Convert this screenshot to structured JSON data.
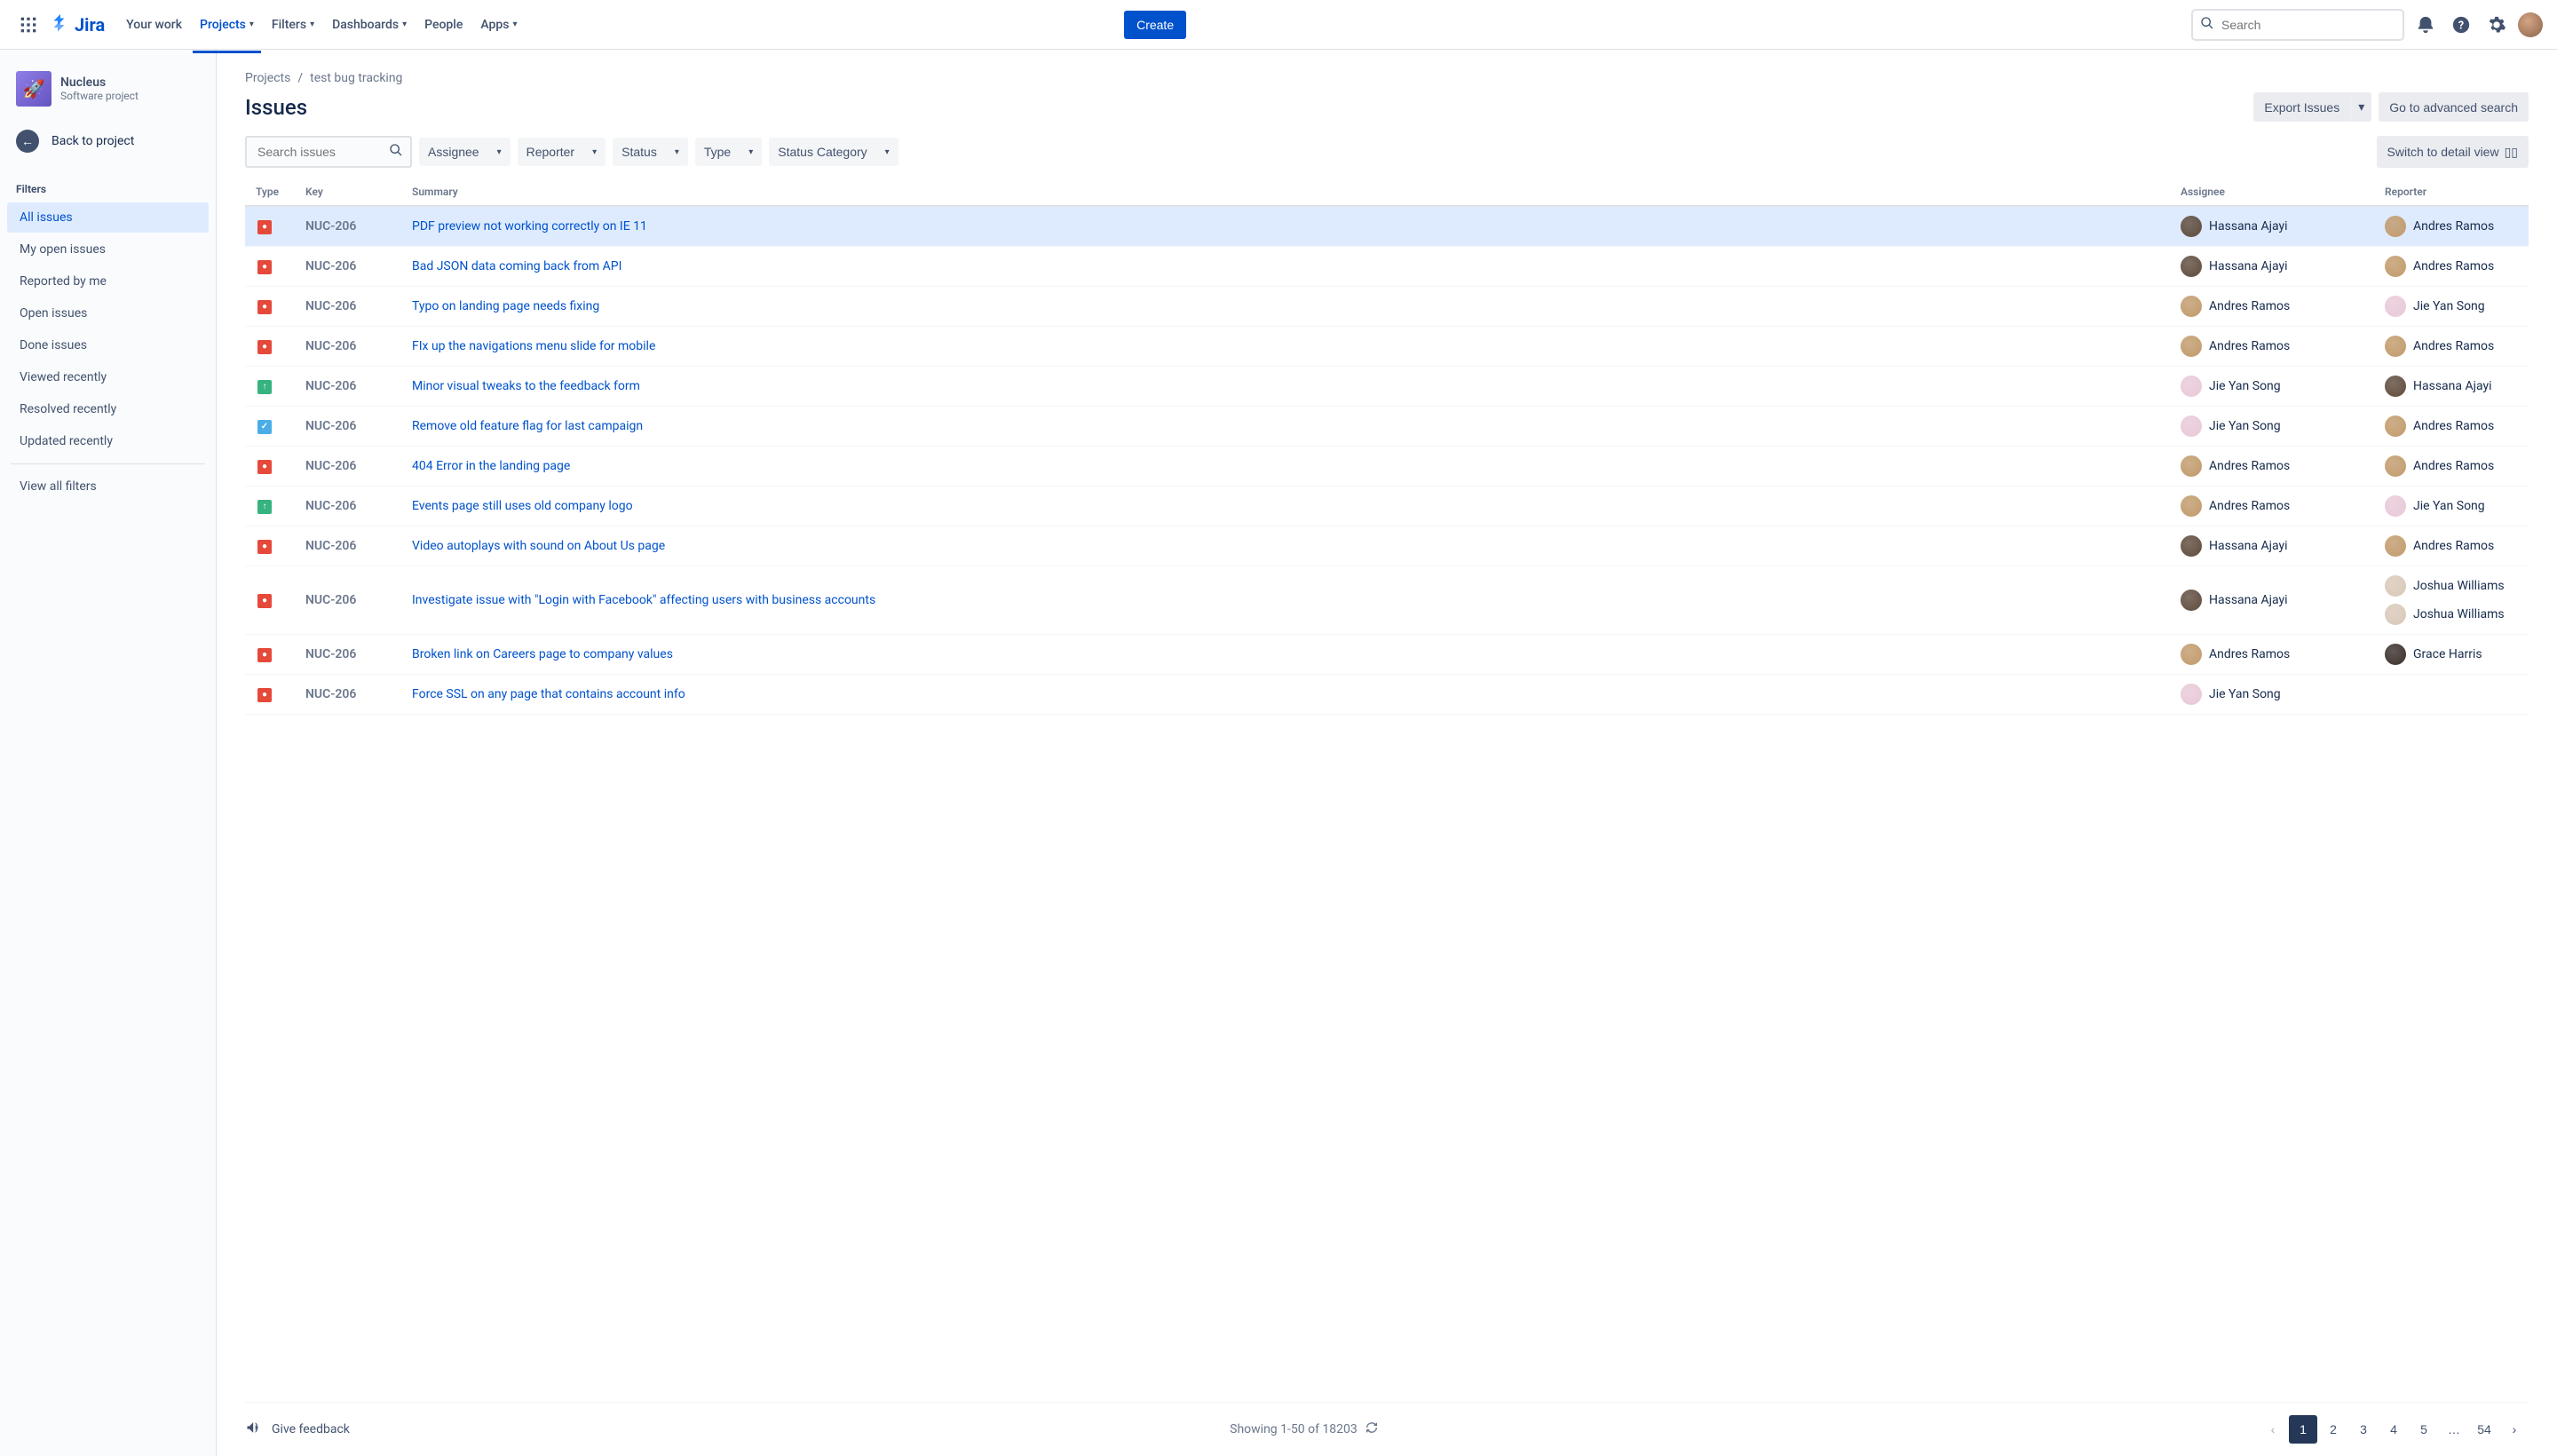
{
  "topnav": {
    "logo_text": "Jira",
    "items": [
      {
        "label": "Your work",
        "has_chevron": false,
        "active": false
      },
      {
        "label": "Projects",
        "has_chevron": true,
        "active": true
      },
      {
        "label": "Filters",
        "has_chevron": true,
        "active": false
      },
      {
        "label": "Dashboards",
        "has_chevron": true,
        "active": false
      },
      {
        "label": "People",
        "has_chevron": false,
        "active": false
      },
      {
        "label": "Apps",
        "has_chevron": true,
        "active": false
      }
    ],
    "create_label": "Create",
    "search_placeholder": "Search"
  },
  "sidebar": {
    "project_name": "Nucleus",
    "project_type": "Software project",
    "back_label": "Back to project",
    "filters_heading": "Filters",
    "filters": [
      {
        "label": "All issues",
        "active": true
      },
      {
        "label": "My open issues",
        "active": false
      },
      {
        "label": "Reported by me",
        "active": false
      },
      {
        "label": "Open issues",
        "active": false
      },
      {
        "label": "Done issues",
        "active": false
      },
      {
        "label": "Viewed recently",
        "active": false
      },
      {
        "label": "Resolved recently",
        "active": false
      },
      {
        "label": "Updated recently",
        "active": false
      }
    ],
    "view_all_label": "View all filters"
  },
  "breadcrumb": {
    "root": "Projects",
    "current": "test bug tracking"
  },
  "page_title": "Issues",
  "actions": {
    "export_label": "Export Issues",
    "advanced_label": "Go to advanced search"
  },
  "filters_bar": {
    "search_placeholder": "Search issues",
    "dropdowns": [
      "Assignee",
      "Reporter",
      "Status",
      "Type",
      "Status Category"
    ],
    "view_switch_label": "Switch to detail view"
  },
  "columns": [
    "Type",
    "Key",
    "Summary",
    "Assignee",
    "Reporter"
  ],
  "issues": [
    {
      "type": "bug",
      "key": "NUC-206",
      "summary": "PDF preview not working correctly on IE 11",
      "assignee": {
        "name": "Hassana Ajayi",
        "color": "#5E4B3C"
      },
      "reporters": [
        {
          "name": "Andres Ramos",
          "color": "#C19A6B"
        }
      ],
      "selected": true
    },
    {
      "type": "bug",
      "key": "NUC-206",
      "summary": "Bad JSON data coming back from API",
      "assignee": {
        "name": "Hassana Ajayi",
        "color": "#5E4B3C"
      },
      "reporters": [
        {
          "name": "Andres Ramos",
          "color": "#C19A6B"
        }
      ]
    },
    {
      "type": "bug",
      "key": "NUC-206",
      "summary": "Typo on landing page needs fixing",
      "assignee": {
        "name": "Andres Ramos",
        "color": "#C19A6B"
      },
      "reporters": [
        {
          "name": "Jie Yan Song",
          "color": "#E8C8D8"
        }
      ]
    },
    {
      "type": "bug",
      "key": "NUC-206",
      "summary": "FIx up the navigations menu slide for mobile",
      "assignee": {
        "name": "Andres Ramos",
        "color": "#C19A6B"
      },
      "reporters": [
        {
          "name": "Andres Ramos",
          "color": "#C19A6B"
        }
      ]
    },
    {
      "type": "improvement",
      "key": "NUC-206",
      "summary": "Minor visual tweaks to the feedback form",
      "assignee": {
        "name": "Jie Yan Song",
        "color": "#E8C8D8"
      },
      "reporters": [
        {
          "name": "Hassana Ajayi",
          "color": "#5E4B3C"
        }
      ]
    },
    {
      "type": "task",
      "key": "NUC-206",
      "summary": "Remove old feature flag for last campaign",
      "assignee": {
        "name": "Jie Yan Song",
        "color": "#E8C8D8"
      },
      "reporters": [
        {
          "name": "Andres Ramos",
          "color": "#C19A6B"
        }
      ]
    },
    {
      "type": "bug",
      "key": "NUC-206",
      "summary": "404 Error in the landing page",
      "assignee": {
        "name": "Andres Ramos",
        "color": "#C19A6B"
      },
      "reporters": [
        {
          "name": "Andres Ramos",
          "color": "#C19A6B"
        }
      ]
    },
    {
      "type": "improvement",
      "key": "NUC-206",
      "summary": "Events page still uses old company logo",
      "assignee": {
        "name": "Andres Ramos",
        "color": "#C19A6B"
      },
      "reporters": [
        {
          "name": "Jie Yan Song",
          "color": "#E8C8D8"
        }
      ]
    },
    {
      "type": "bug",
      "key": "NUC-206",
      "summary": "Video autoplays with sound on About Us page",
      "assignee": {
        "name": "Hassana Ajayi",
        "color": "#5E4B3C"
      },
      "reporters": [
        {
          "name": "Andres Ramos",
          "color": "#C19A6B"
        }
      ]
    },
    {
      "type": "bug",
      "key": "NUC-206",
      "summary": "Investigate issue with \"Login with Facebook\" affecting users with business accounts",
      "assignee": {
        "name": "Hassana Ajayi",
        "color": "#5E4B3C"
      },
      "reporters": [
        {
          "name": "Joshua Williams",
          "color": "#D8C8B8"
        },
        {
          "name": "Joshua Williams",
          "color": "#D8C8B8"
        }
      ]
    },
    {
      "type": "bug",
      "key": "NUC-206",
      "summary": "Broken link on Careers page to company values",
      "assignee": {
        "name": "Andres Ramos",
        "color": "#C19A6B"
      },
      "reporters": [
        {
          "name": "Grace Harris",
          "color": "#3A2F2A"
        }
      ]
    },
    {
      "type": "bug",
      "key": "NUC-206",
      "summary": "Force SSL on any page that contains account info",
      "assignee": {
        "name": "Jie Yan Song",
        "color": "#E8C8D8"
      },
      "reporters": []
    }
  ],
  "footer": {
    "feedback_label": "Give feedback",
    "showing_label": "Showing 1-50 of 18203",
    "pages": [
      "1",
      "2",
      "3",
      "4",
      "5",
      "…",
      "54"
    ]
  }
}
